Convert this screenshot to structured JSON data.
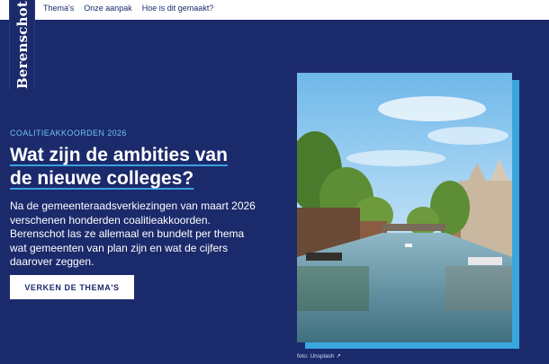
{
  "nav": {
    "items": [
      {
        "label": "Thema's"
      },
      {
        "label": "Onze aanpak"
      },
      {
        "label": "Hoe is dit gemaakt?"
      }
    ]
  },
  "logo": {
    "text": "Berenschot"
  },
  "hero": {
    "eyebrow": "COALITIEAKKOORDEN 2026",
    "headline_line1": "Wat zijn de ambities van",
    "headline_line2": "de nieuwe colleges?",
    "description": "Na de gemeenteraadsverkiezingen van maart 2026 verschenen honderden coalitieakkoorden. Berenschot las ze allemaal en bundelt per thema wat gemeenten van plan zijn en wat de cijfers daarover zeggen.",
    "cta_label": "VERKEN DE THEMA'S"
  },
  "photo": {
    "alt": "Amsterdam canal with houseboats and trees",
    "caption": "foto: Unsplash ↗"
  },
  "colors": {
    "background": "#1b2a6b",
    "accent": "#3aa6e0",
    "eyebrow": "#6fc3f2",
    "button_bg": "#ffffff"
  }
}
